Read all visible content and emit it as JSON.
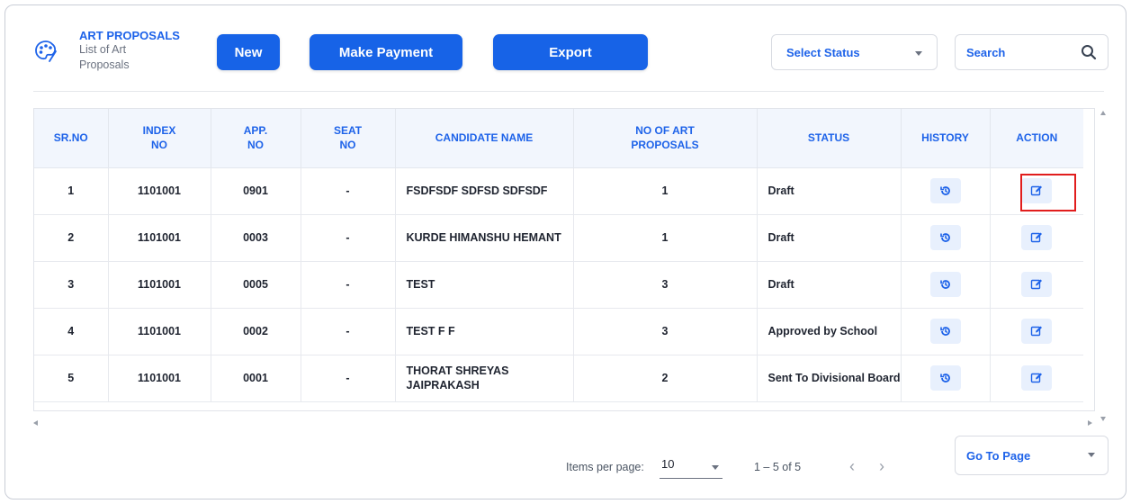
{
  "header": {
    "title": "ART PROPOSALS",
    "subtitle": "List of Art Proposals",
    "logo_icon": "palette-icon"
  },
  "toolbar": {
    "new_label": "New",
    "make_payment_label": "Make Payment",
    "export_label": "Export"
  },
  "filters": {
    "status_placeholder": "Select Status",
    "search_placeholder": "Search"
  },
  "table": {
    "columns": [
      "SR.NO",
      "INDEX NO",
      "APP. NO",
      "SEAT NO",
      "CANDIDATE NAME",
      "NO OF ART PROPOSALS",
      "STATUS",
      "HISTORY",
      "ACTION"
    ],
    "rows": [
      {
        "sr": "1",
        "index": "1101001",
        "app": "0901",
        "seat": "-",
        "name": "FSDFSDF SDFSD SDFSDF",
        "count": "1",
        "status": "Draft"
      },
      {
        "sr": "2",
        "index": "1101001",
        "app": "0003",
        "seat": "-",
        "name": "KURDE HIMANSHU HEMANT",
        "count": "1",
        "status": "Draft"
      },
      {
        "sr": "3",
        "index": "1101001",
        "app": "0005",
        "seat": "-",
        "name": "TEST",
        "count": "3",
        "status": "Draft"
      },
      {
        "sr": "4",
        "index": "1101001",
        "app": "0002",
        "seat": "-",
        "name": "TEST F F",
        "count": "3",
        "status": "Approved by School"
      },
      {
        "sr": "5",
        "index": "1101001",
        "app": "0001",
        "seat": "-",
        "name": "THORAT SHREYAS JAIPRAKASH",
        "count": "2",
        "status": "Sent To Divisional Board"
      }
    ],
    "history_icon": "history-icon",
    "action_icon": "edit-icon"
  },
  "pagination": {
    "items_per_page_label": "Items per page:",
    "items_per_page_value": "10",
    "range_label": "1 – 5 of 5",
    "goto_label": "Go To Page"
  },
  "colors": {
    "accent": "#1763e7",
    "header_bg": "#f2f6fd",
    "highlight": "#e11d1d"
  }
}
